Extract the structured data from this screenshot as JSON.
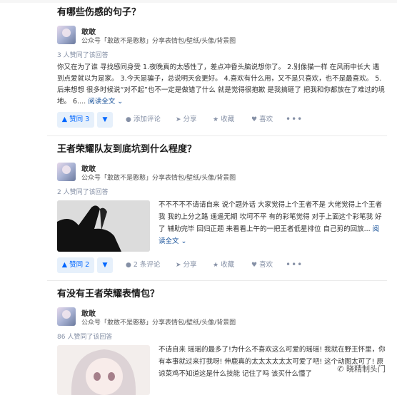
{
  "answers": [
    {
      "question": "有哪些伤感的句子？",
      "author_name": "敢敢",
      "author_bio": "公众号「敢敢不是憨憨」分享表情包/壁纸/头像/背景图",
      "votes_text": "3 人赞同了该回答",
      "excerpt": "你又在为了谁 寻找感同身受 1.夜晚真的太感性了，差点冲昏头脑说想你了。 2.别像猫一样 在风雨中长大 遇到点爱就以为是家。 3.今天是骗子，总说明天会更好。 4.喜欢有什么用，又不是只喜欢，也不是最喜欢。 5.后来想想 很多时候说“对不起”也不一定是做错了什么 就是觉得很抱歉 是我搞砸了 把我和你都放在了难过的境地。 6....",
      "read_more": "阅读全文 ⌄",
      "vote_label": "▲ 赞同 3",
      "comment_label": "添加评论",
      "share_label": "分享",
      "favorite_label": "收藏",
      "like_label": "喜欢"
    },
    {
      "question": "王者荣耀队友到底坑到什么程度？",
      "author_name": "敢敢",
      "author_bio": "公众号「敢敢不是憨憨」分享表情包/壁纸/头像/背景图",
      "votes_text": "2 人赞同了该回答",
      "excerpt": "不不不不不请请自来 说个题外话 大家觉得上个王者不是 大佬觉得上个王者 我 我的上分之路 遥遥无期 坎坷不平 有的彩笔觉得 对于上面这个彩笔我 好了 辅助完毕 回归正题 来看看上午的一把王者低星排位 自己剪的回放...",
      "read_more": "阅读全文 ⌄",
      "vote_label": "▲ 赞同 2",
      "comment_label": "2 条评论",
      "share_label": "分享",
      "favorite_label": "收藏",
      "like_label": "喜欢"
    },
    {
      "question": "有没有王者荣耀表情包？",
      "author_name": "敢敢",
      "author_bio": "公众号「敢敢不是憨憨」分享表情包/壁纸/头像/背景图",
      "votes_text": "86 人赞同了该回答",
      "excerpt": "不请自来 瑶瑶的最多了!为什么不喜欢这么可爱的瑶瑶! 我就在野王怀里，你有本事就过来打我呀! 伸鹿真的太太太太太太可爱了吧! 这个动图太可了! 原谅菜鸡不知道这是什么技能 记住了吗 该买什么懂了"
    }
  ],
  "down_label": "▼",
  "more_label": "•••",
  "watermark": "✆ 晓精制头门"
}
